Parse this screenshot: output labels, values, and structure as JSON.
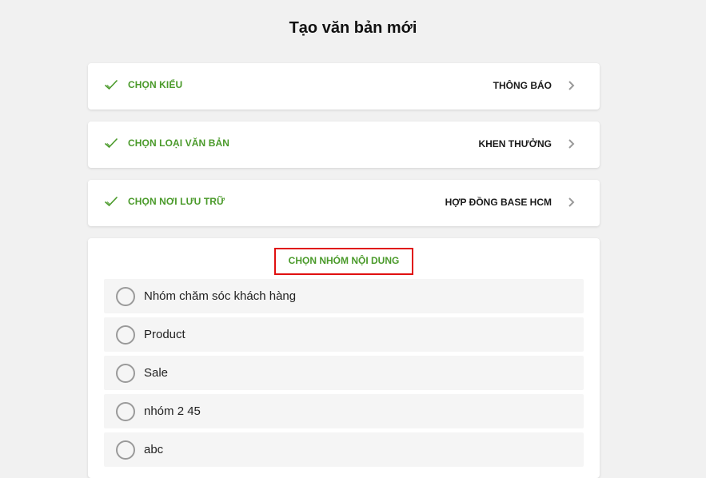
{
  "page": {
    "title": "Tạo văn bản mới"
  },
  "steps": [
    {
      "label": "CHỌN KIỂU",
      "value": "THÔNG BÁO"
    },
    {
      "label": "CHỌN LOẠI VĂN BẢN",
      "value": "KHEN THƯỞNG"
    },
    {
      "label": "CHỌN NƠI LƯU TRỮ",
      "value": "HỢP ĐỒNG BASE HCM"
    }
  ],
  "content_group": {
    "title": "CHỌN NHÓM NỘI DUNG",
    "options": [
      {
        "label": "Nhóm chăm sóc khách hàng"
      },
      {
        "label": "Product"
      },
      {
        "label": "Sale"
      },
      {
        "label": "nhóm 2 45"
      },
      {
        "label": "abc"
      }
    ]
  },
  "colors": {
    "accent_green": "#4a9a2a",
    "highlight_border": "#e01010",
    "background": "#f1f1f1"
  },
  "icons": {
    "step_done": "check-icon",
    "step_nav": "chevron-right-icon",
    "option": "radio-icon"
  }
}
